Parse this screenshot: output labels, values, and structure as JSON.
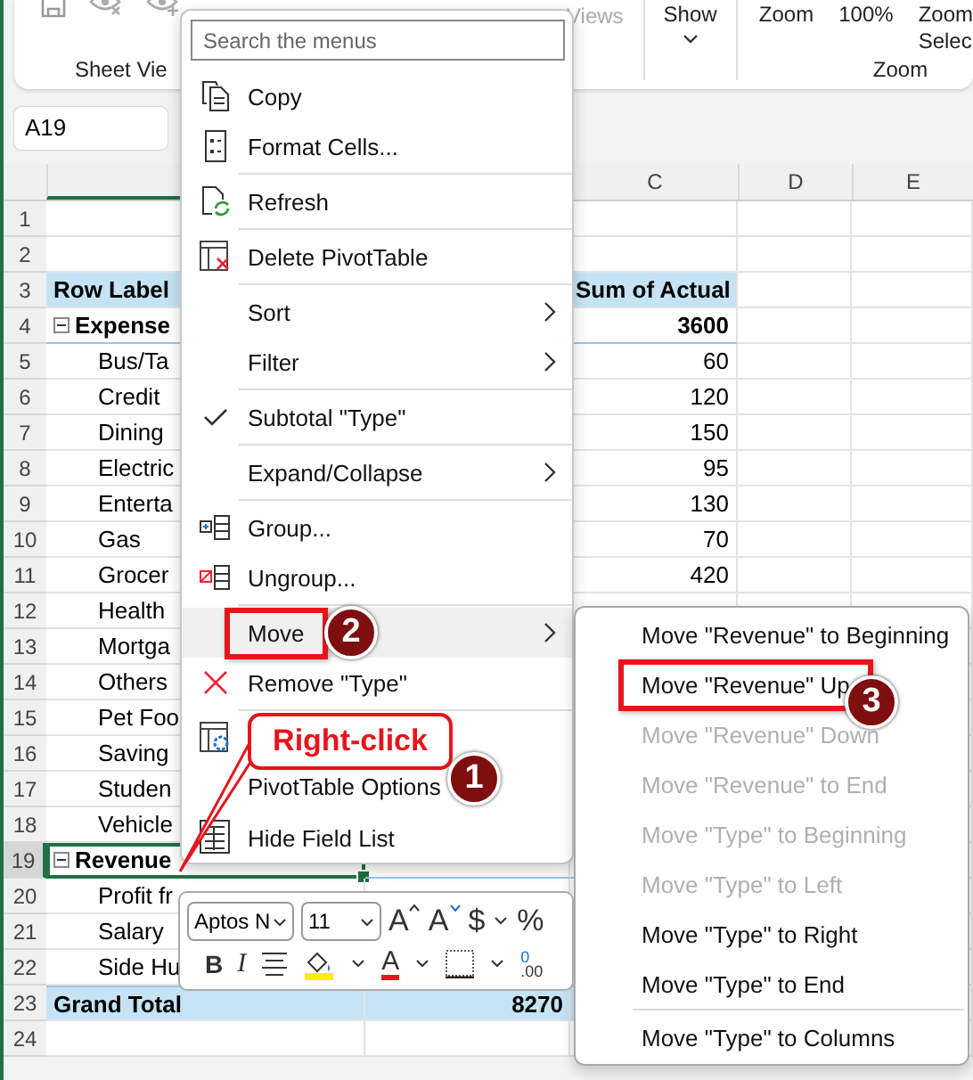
{
  "ribbon": {
    "sheet_view_label": "Sheet Vie",
    "views_label": "Views",
    "show_label": "Show",
    "zoom_buttons": [
      {
        "label": "Zoom"
      },
      {
        "label": "100%"
      },
      {
        "label": "Zoom",
        "line2": "Selec"
      }
    ],
    "zoom_label": "Zoom"
  },
  "name_box": "A19",
  "columns": [
    {
      "label": "C"
    },
    {
      "label": "D"
    },
    {
      "label": "E"
    }
  ],
  "rows": [
    {
      "number": "1",
      "kind": "blank",
      "selected": false
    },
    {
      "number": "2",
      "kind": "blank",
      "selected": false
    },
    {
      "number": "3",
      "kind": "header",
      "label": "Row Label",
      "value": "Sum of Actual",
      "selected": false
    },
    {
      "number": "4",
      "kind": "group",
      "label": "Expense",
      "value": "3600",
      "expanded": true,
      "selected": false
    },
    {
      "number": "5",
      "kind": "item",
      "label": "Bus/Ta",
      "value": "60",
      "selected": false
    },
    {
      "number": "6",
      "kind": "item",
      "label": "Credit",
      "value": "120",
      "selected": false
    },
    {
      "number": "7",
      "kind": "item",
      "label": "Dining",
      "value": "150",
      "selected": false
    },
    {
      "number": "8",
      "kind": "item",
      "label": "Electric",
      "value": "95",
      "selected": false
    },
    {
      "number": "9",
      "kind": "item",
      "label": "Enterta",
      "value": "130",
      "selected": false
    },
    {
      "number": "10",
      "kind": "item",
      "label": "Gas",
      "value": "70",
      "selected": false
    },
    {
      "number": "11",
      "kind": "item",
      "label": "Grocer",
      "value": "420",
      "selected": false
    },
    {
      "number": "12",
      "kind": "item",
      "label": "Health",
      "selected": false
    },
    {
      "number": "13",
      "kind": "item",
      "label": "Mortga",
      "selected": false
    },
    {
      "number": "14",
      "kind": "item",
      "label": "Others",
      "selected": false
    },
    {
      "number": "15",
      "kind": "item",
      "label": "Pet Foo",
      "selected": false
    },
    {
      "number": "16",
      "kind": "item",
      "label": "Saving",
      "selected": false
    },
    {
      "number": "17",
      "kind": "item",
      "label": "Studen",
      "selected": false
    },
    {
      "number": "18",
      "kind": "item",
      "label": "Vehicle",
      "selected": false
    },
    {
      "number": "19",
      "kind": "group",
      "label": "Revenue",
      "expanded": true,
      "selected": true
    },
    {
      "number": "20",
      "kind": "item",
      "label": "Profit fr",
      "selected": false
    },
    {
      "number": "21",
      "kind": "item",
      "label": "Salary",
      "selected": false
    },
    {
      "number": "22",
      "kind": "item",
      "label": "Side Hu",
      "selected": false
    },
    {
      "number": "23",
      "kind": "total",
      "label": "Grand Total",
      "value": "8270",
      "selected": false
    },
    {
      "number": "24",
      "kind": "blank",
      "selected": false
    }
  ],
  "context_menu": {
    "search_placeholder": "Search the menus",
    "items": [
      {
        "kind": "command",
        "label": "Copy",
        "submenu": false,
        "checked": false,
        "selected": false,
        "annotated": false
      },
      {
        "kind": "command",
        "label": "Format Cells...",
        "submenu": false,
        "checked": false,
        "selected": false,
        "annotated": false
      },
      {
        "kind": "separator"
      },
      {
        "kind": "command",
        "label": "Refresh",
        "submenu": false,
        "checked": false,
        "selected": false,
        "annotated": false
      },
      {
        "kind": "separator"
      },
      {
        "kind": "command",
        "label": "Delete PivotTable",
        "submenu": false,
        "checked": false,
        "selected": false,
        "annotated": false
      },
      {
        "kind": "separator"
      },
      {
        "kind": "command",
        "label": "Sort",
        "submenu": true,
        "checked": false,
        "selected": false,
        "annotated": false
      },
      {
        "kind": "command",
        "label": "Filter",
        "submenu": true,
        "checked": false,
        "selected": false,
        "annotated": false
      },
      {
        "kind": "separator"
      },
      {
        "kind": "command",
        "label": "Subtotal \"Type\"",
        "submenu": false,
        "checked": true,
        "selected": false,
        "annotated": false
      },
      {
        "kind": "separator"
      },
      {
        "kind": "command",
        "label": "Expand/Collapse",
        "submenu": true,
        "checked": false,
        "selected": false,
        "annotated": false
      },
      {
        "kind": "separator"
      },
      {
        "kind": "command",
        "label": "Group...",
        "submenu": false,
        "checked": false,
        "selected": false,
        "annotated": false
      },
      {
        "kind": "command",
        "label": "Ungroup...",
        "submenu": false,
        "checked": false,
        "selected": false,
        "annotated": false
      },
      {
        "kind": "separator"
      },
      {
        "kind": "command",
        "label": "Move",
        "submenu": true,
        "checked": false,
        "selected": true,
        "annotated": true
      },
      {
        "kind": "command",
        "label": "Remove \"Type\"",
        "submenu": false,
        "checked": false,
        "selected": false,
        "annotated": false
      },
      {
        "kind": "separator"
      },
      {
        "kind": "tall",
        "label": "PivotTable Options",
        "submenu": false,
        "checked": false,
        "selected": false,
        "annotated": false
      },
      {
        "kind": "command",
        "label": "Hide Field List",
        "submenu": false,
        "checked": false,
        "selected": false,
        "annotated": false
      }
    ]
  },
  "submenu": {
    "items": [
      {
        "kind": "command",
        "label": "Move \"Revenue\" to Beginning",
        "disabled": false,
        "annotated": false
      },
      {
        "kind": "command",
        "label": "Move \"Revenue\" Up",
        "disabled": false,
        "annotated": true
      },
      {
        "kind": "command",
        "label": "Move \"Revenue\" Down",
        "disabled": true,
        "annotated": false
      },
      {
        "kind": "command",
        "label": "Move \"Revenue\" to End",
        "disabled": true,
        "annotated": false
      },
      {
        "kind": "command",
        "label": "Move \"Type\" to Beginning",
        "disabled": true,
        "annotated": false
      },
      {
        "kind": "command",
        "label": "Move \"Type\" to Left",
        "disabled": true,
        "annotated": false
      },
      {
        "kind": "command",
        "label": "Move \"Type\" to Right",
        "disabled": false,
        "annotated": false
      },
      {
        "kind": "command",
        "label": "Move \"Type\" to End",
        "disabled": false,
        "annotated": false
      },
      {
        "kind": "separator"
      },
      {
        "kind": "command",
        "label": "Move \"Type\" to Columns",
        "disabled": false,
        "annotated": false
      }
    ]
  },
  "mini_toolbar": {
    "row1": [
      {
        "kind": "font",
        "value": "Aptos N"
      },
      {
        "kind": "size",
        "value": "11"
      },
      {
        "kind": "grow",
        "label": "A"
      },
      {
        "kind": "shrink",
        "label": "A"
      },
      {
        "kind": "currency",
        "label": "$"
      },
      {
        "kind": "menu"
      },
      {
        "kind": "percent",
        "label": "%"
      }
    ],
    "row2": [
      {
        "kind": "bold",
        "label": "B"
      },
      {
        "kind": "italic",
        "label": "I"
      },
      {
        "kind": "align"
      },
      {
        "kind": "fill"
      },
      {
        "kind": "menu"
      },
      {
        "kind": "font_color",
        "label": "A"
      },
      {
        "kind": "menu"
      },
      {
        "kind": "borders"
      },
      {
        "kind": "menu"
      },
      {
        "kind": "decimal",
        "label": "0",
        "label2": ".00"
      }
    ]
  },
  "annotations": [
    {
      "kind": "bubble",
      "text": "Right-click"
    },
    {
      "kind": "step",
      "number": "1"
    },
    {
      "kind": "step",
      "number": "2"
    },
    {
      "kind": "step",
      "number": "3"
    }
  ]
}
